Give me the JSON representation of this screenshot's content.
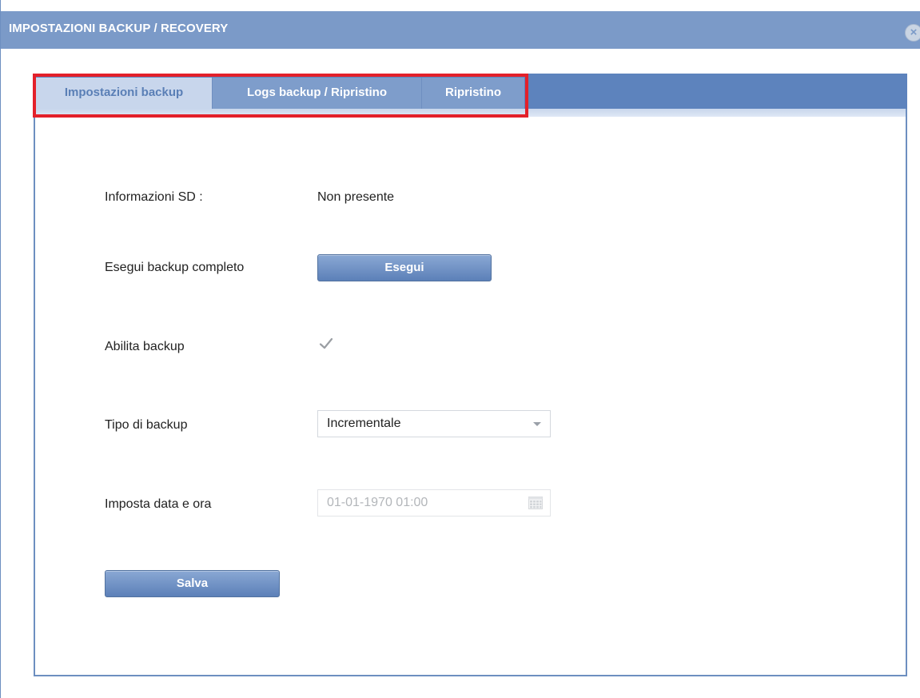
{
  "window": {
    "title": "IMPOSTAZIONI BACKUP / RECOVERY",
    "close_icon": "close-circle-icon"
  },
  "tabs": [
    {
      "label": "Impostazioni backup",
      "active": true
    },
    {
      "label": "Logs backup / Ripristino",
      "active": false
    },
    {
      "label": "Ripristino",
      "active": false
    }
  ],
  "form": {
    "sd_info": {
      "label": "Informazioni SD :",
      "value": "Non presente"
    },
    "full_backup": {
      "label": "Esegui backup completo",
      "button": "Esegui"
    },
    "enable_backup": {
      "label": "Abilita backup",
      "checked": true
    },
    "backup_type": {
      "label": "Tipo di backup",
      "selected": "Incrementale"
    },
    "datetime": {
      "label": "Imposta data e ora",
      "value": "01-01-1970 01:00",
      "icon": "calendar-icon"
    },
    "save_button": "Salva"
  },
  "colors": {
    "titlebar": "#7b9ac8",
    "tabbar": "#5d83bd",
    "active_tab": "#c8d6ec",
    "highlight": "#e3202a"
  }
}
